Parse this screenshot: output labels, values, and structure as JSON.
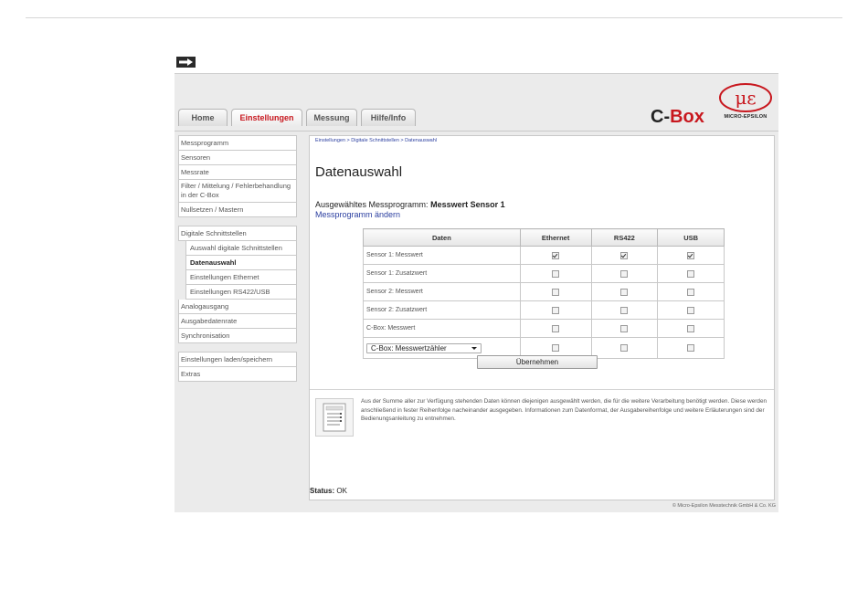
{
  "tabs": [
    "Home",
    "Einstellungen",
    "Messung",
    "Hilfe/Info"
  ],
  "brand": {
    "prefix": "C-",
    "name": "Box",
    "logo_text": "MICRO-EPSILON"
  },
  "sidebar": {
    "group1": [
      "Messprogramm",
      "Sensoren",
      "Messrate",
      "Filter / Mittelung / Fehlerbehandlung in der C-Box",
      "Nullsetzen / Mastern"
    ],
    "group2_header": "Digitale Schnittstellen",
    "group2_sub": [
      "Auswahl digitale Schnittstellen",
      "Datenauswahl",
      "Einstellungen Ethernet",
      "Einstellungen RS422/USB"
    ],
    "group2_rest": [
      "Analogausgang",
      "Ausgabedatenrate",
      "Synchronisation"
    ],
    "group3": [
      "Einstellungen laden/speichern",
      "Extras"
    ]
  },
  "breadcrumb": "Einstellungen > Digitale Schnittstellen > Datenauswahl",
  "page_title": "Datenauswahl",
  "selected_program": {
    "label": "Ausgewähltes Messprogramm:",
    "value": "Messwert Sensor 1"
  },
  "change_link": "Messprogramm ändern",
  "table": {
    "headers": [
      "Daten",
      "Ethernet",
      "RS422",
      "USB"
    ],
    "rows": [
      {
        "label": "Sensor 1: Messwert",
        "ethernet": true,
        "rs422": true,
        "usb": true
      },
      {
        "label": "Sensor 1: Zusatzwert",
        "ethernet": false,
        "rs422": false,
        "usb": false
      },
      {
        "label": "Sensor 2: Messwert",
        "ethernet": false,
        "rs422": false,
        "usb": false
      },
      {
        "label": "Sensor 2: Zusatzwert",
        "ethernet": false,
        "rs422": false,
        "usb": false
      },
      {
        "label": "C-Box: Messwert",
        "ethernet": false,
        "rs422": false,
        "usb": false
      },
      {
        "label": "C-Box: Messwertzähler",
        "ethernet": false,
        "rs422": false,
        "usb": false,
        "dropdown": true
      }
    ]
  },
  "apply_button": "Übernehmen",
  "info_text": "Aus der Summe aller zur Verfügung stehenden Daten können diejenigen ausgewählt werden, die für die weitere Verarbeitung benötigt werden. Diese werden anschließend in fester Reihenfolge nacheinander ausgegeben. Informationen zum Datenformat, der Ausgabereihenfolge und weitere Erläuterungen sind der Bedienungsanleitung zu entnehmen.",
  "status": {
    "label": "Status:",
    "value": "OK"
  },
  "footer": "© Micro-Epsilon Messtechnik GmbH & Co. KG",
  "colors": {
    "accent": "#c8171e",
    "link": "#2b3fa0"
  },
  "icons": {
    "arrow": "arrow-right-icon",
    "info": "document-list-icon",
    "logo": "micro-epsilon-logo-icon"
  }
}
